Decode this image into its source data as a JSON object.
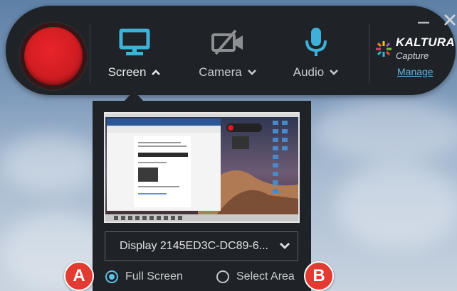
{
  "sources": {
    "screen": {
      "label": "Screen",
      "icon": "monitor-icon",
      "expanded": true
    },
    "camera": {
      "label": "Camera",
      "icon": "camera-off-icon",
      "expanded": false
    },
    "audio": {
      "label": "Audio",
      "icon": "microphone-icon",
      "expanded": false
    }
  },
  "brand": {
    "name": "KALTURA",
    "product": "Capture",
    "manage_link": "Manage"
  },
  "screen_panel": {
    "display_select": {
      "value": "Display 2145ED3C-DC89-6..."
    },
    "options": [
      {
        "label": "Full Screen",
        "selected": true
      },
      {
        "label": "Select Area",
        "selected": false
      }
    ]
  },
  "callouts": {
    "a": "A",
    "b": "B"
  },
  "colors": {
    "accent": "#5dc0e6",
    "record": "#d01d22",
    "toolbar": "#1f2328",
    "link": "#5fb6df",
    "callout": "#e23b32"
  }
}
